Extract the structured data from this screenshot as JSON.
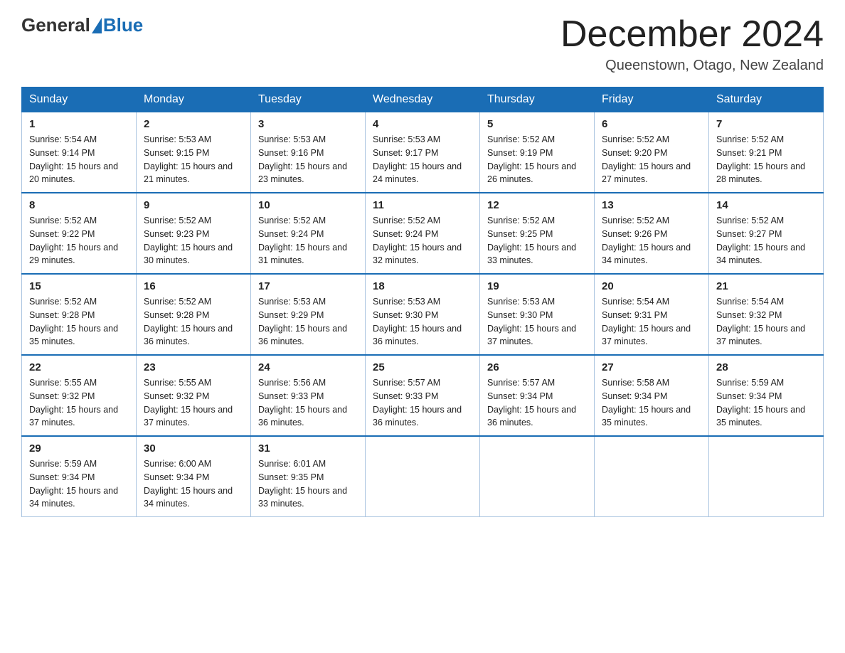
{
  "header": {
    "logo_general": "General",
    "logo_blue": "Blue",
    "title": "December 2024",
    "location": "Queenstown, Otago, New Zealand"
  },
  "columns": [
    "Sunday",
    "Monday",
    "Tuesday",
    "Wednesday",
    "Thursday",
    "Friday",
    "Saturday"
  ],
  "weeks": [
    [
      {
        "day": "1",
        "sunrise": "Sunrise: 5:54 AM",
        "sunset": "Sunset: 9:14 PM",
        "daylight": "Daylight: 15 hours and 20 minutes."
      },
      {
        "day": "2",
        "sunrise": "Sunrise: 5:53 AM",
        "sunset": "Sunset: 9:15 PM",
        "daylight": "Daylight: 15 hours and 21 minutes."
      },
      {
        "day": "3",
        "sunrise": "Sunrise: 5:53 AM",
        "sunset": "Sunset: 9:16 PM",
        "daylight": "Daylight: 15 hours and 23 minutes."
      },
      {
        "day": "4",
        "sunrise": "Sunrise: 5:53 AM",
        "sunset": "Sunset: 9:17 PM",
        "daylight": "Daylight: 15 hours and 24 minutes."
      },
      {
        "day": "5",
        "sunrise": "Sunrise: 5:52 AM",
        "sunset": "Sunset: 9:19 PM",
        "daylight": "Daylight: 15 hours and 26 minutes."
      },
      {
        "day": "6",
        "sunrise": "Sunrise: 5:52 AM",
        "sunset": "Sunset: 9:20 PM",
        "daylight": "Daylight: 15 hours and 27 minutes."
      },
      {
        "day": "7",
        "sunrise": "Sunrise: 5:52 AM",
        "sunset": "Sunset: 9:21 PM",
        "daylight": "Daylight: 15 hours and 28 minutes."
      }
    ],
    [
      {
        "day": "8",
        "sunrise": "Sunrise: 5:52 AM",
        "sunset": "Sunset: 9:22 PM",
        "daylight": "Daylight: 15 hours and 29 minutes."
      },
      {
        "day": "9",
        "sunrise": "Sunrise: 5:52 AM",
        "sunset": "Sunset: 9:23 PM",
        "daylight": "Daylight: 15 hours and 30 minutes."
      },
      {
        "day": "10",
        "sunrise": "Sunrise: 5:52 AM",
        "sunset": "Sunset: 9:24 PM",
        "daylight": "Daylight: 15 hours and 31 minutes."
      },
      {
        "day": "11",
        "sunrise": "Sunrise: 5:52 AM",
        "sunset": "Sunset: 9:24 PM",
        "daylight": "Daylight: 15 hours and 32 minutes."
      },
      {
        "day": "12",
        "sunrise": "Sunrise: 5:52 AM",
        "sunset": "Sunset: 9:25 PM",
        "daylight": "Daylight: 15 hours and 33 minutes."
      },
      {
        "day": "13",
        "sunrise": "Sunrise: 5:52 AM",
        "sunset": "Sunset: 9:26 PM",
        "daylight": "Daylight: 15 hours and 34 minutes."
      },
      {
        "day": "14",
        "sunrise": "Sunrise: 5:52 AM",
        "sunset": "Sunset: 9:27 PM",
        "daylight": "Daylight: 15 hours and 34 minutes."
      }
    ],
    [
      {
        "day": "15",
        "sunrise": "Sunrise: 5:52 AM",
        "sunset": "Sunset: 9:28 PM",
        "daylight": "Daylight: 15 hours and 35 minutes."
      },
      {
        "day": "16",
        "sunrise": "Sunrise: 5:52 AM",
        "sunset": "Sunset: 9:28 PM",
        "daylight": "Daylight: 15 hours and 36 minutes."
      },
      {
        "day": "17",
        "sunrise": "Sunrise: 5:53 AM",
        "sunset": "Sunset: 9:29 PM",
        "daylight": "Daylight: 15 hours and 36 minutes."
      },
      {
        "day": "18",
        "sunrise": "Sunrise: 5:53 AM",
        "sunset": "Sunset: 9:30 PM",
        "daylight": "Daylight: 15 hours and 36 minutes."
      },
      {
        "day": "19",
        "sunrise": "Sunrise: 5:53 AM",
        "sunset": "Sunset: 9:30 PM",
        "daylight": "Daylight: 15 hours and 37 minutes."
      },
      {
        "day": "20",
        "sunrise": "Sunrise: 5:54 AM",
        "sunset": "Sunset: 9:31 PM",
        "daylight": "Daylight: 15 hours and 37 minutes."
      },
      {
        "day": "21",
        "sunrise": "Sunrise: 5:54 AM",
        "sunset": "Sunset: 9:32 PM",
        "daylight": "Daylight: 15 hours and 37 minutes."
      }
    ],
    [
      {
        "day": "22",
        "sunrise": "Sunrise: 5:55 AM",
        "sunset": "Sunset: 9:32 PM",
        "daylight": "Daylight: 15 hours and 37 minutes."
      },
      {
        "day": "23",
        "sunrise": "Sunrise: 5:55 AM",
        "sunset": "Sunset: 9:32 PM",
        "daylight": "Daylight: 15 hours and 37 minutes."
      },
      {
        "day": "24",
        "sunrise": "Sunrise: 5:56 AM",
        "sunset": "Sunset: 9:33 PM",
        "daylight": "Daylight: 15 hours and 36 minutes."
      },
      {
        "day": "25",
        "sunrise": "Sunrise: 5:57 AM",
        "sunset": "Sunset: 9:33 PM",
        "daylight": "Daylight: 15 hours and 36 minutes."
      },
      {
        "day": "26",
        "sunrise": "Sunrise: 5:57 AM",
        "sunset": "Sunset: 9:34 PM",
        "daylight": "Daylight: 15 hours and 36 minutes."
      },
      {
        "day": "27",
        "sunrise": "Sunrise: 5:58 AM",
        "sunset": "Sunset: 9:34 PM",
        "daylight": "Daylight: 15 hours and 35 minutes."
      },
      {
        "day": "28",
        "sunrise": "Sunrise: 5:59 AM",
        "sunset": "Sunset: 9:34 PM",
        "daylight": "Daylight: 15 hours and 35 minutes."
      }
    ],
    [
      {
        "day": "29",
        "sunrise": "Sunrise: 5:59 AM",
        "sunset": "Sunset: 9:34 PM",
        "daylight": "Daylight: 15 hours and 34 minutes."
      },
      {
        "day": "30",
        "sunrise": "Sunrise: 6:00 AM",
        "sunset": "Sunset: 9:34 PM",
        "daylight": "Daylight: 15 hours and 34 minutes."
      },
      {
        "day": "31",
        "sunrise": "Sunrise: 6:01 AM",
        "sunset": "Sunset: 9:35 PM",
        "daylight": "Daylight: 15 hours and 33 minutes."
      },
      null,
      null,
      null,
      null
    ]
  ]
}
